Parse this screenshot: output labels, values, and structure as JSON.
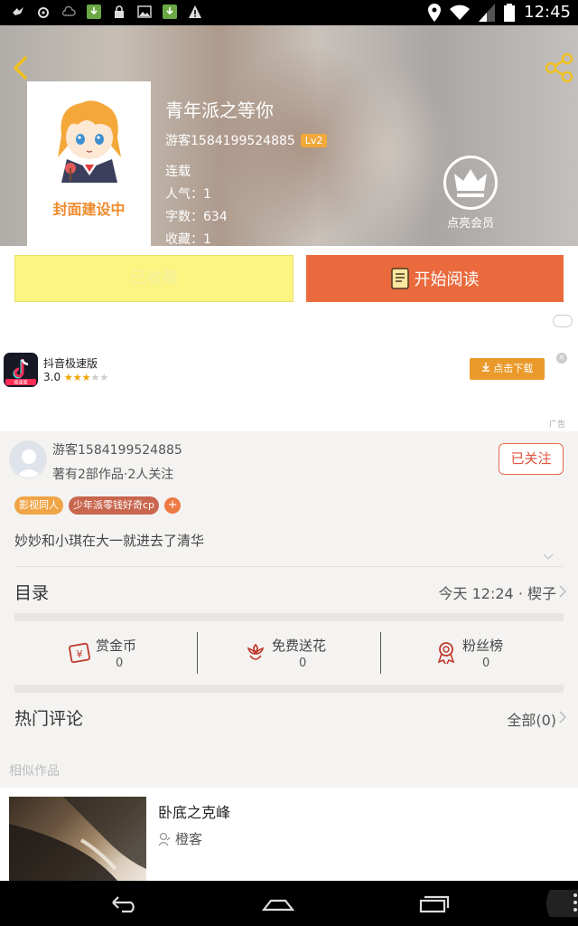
{
  "status_bar": {
    "time": "12:45"
  },
  "book": {
    "cover_label": "封面建设中",
    "title": "青年派之等你",
    "author": "游客1584199524885",
    "level": "Lv2",
    "status": "连载",
    "popularity": "人气：1",
    "word_count": "字数：634",
    "favorites": "收藏：1"
  },
  "vip": {
    "label": "点亮会员"
  },
  "actions": {
    "favorite_label": "已收藏",
    "read_label": "开始阅读"
  },
  "ad": {
    "app_name": "抖音极速版",
    "rating": "3.0",
    "download_label": "点击下载",
    "ad_tag": "广告",
    "icon_text": "极速版"
  },
  "author_info": {
    "name": "游客1584199524885",
    "works": "著有2部作品·2人关注",
    "follow_label": "已关注",
    "tags": [
      "影视同人",
      "少年派零钱好奇cp"
    ],
    "add_tag": "+",
    "description": "妙妙和小琪在大一就进去了清华"
  },
  "toc": {
    "title": "目录",
    "update": "今天 12:24 · 楔子"
  },
  "stats": [
    {
      "label": "赏金币",
      "value": "0",
      "icon": "reward-coin-icon"
    },
    {
      "label": "免费送花",
      "value": "0",
      "icon": "flower-icon"
    },
    {
      "label": "粉丝榜",
      "value": "0",
      "icon": "medal-icon"
    }
  ],
  "comments": {
    "title": "热门评论",
    "all_label": "全部(0)"
  },
  "similar": {
    "section_label": "相似作品",
    "items": [
      {
        "title": "卧底之克峰",
        "author": "橙客"
      }
    ]
  },
  "colors": {
    "accent": "#ea6a3d",
    "favorite_bg": "#fdf582",
    "badge": "#f2a93b"
  }
}
